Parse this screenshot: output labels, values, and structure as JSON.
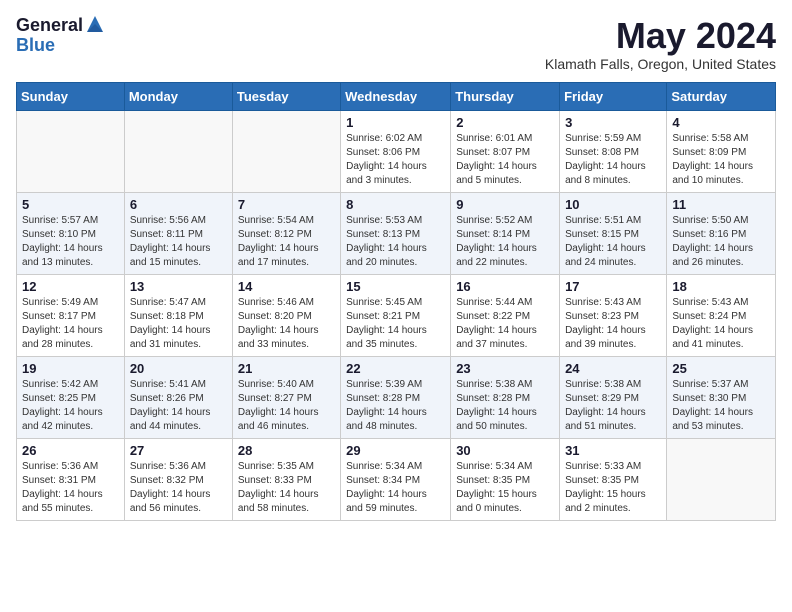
{
  "logo": {
    "general": "General",
    "blue": "Blue"
  },
  "title": "May 2024",
  "location": "Klamath Falls, Oregon, United States",
  "weekdays": [
    "Sunday",
    "Monday",
    "Tuesday",
    "Wednesday",
    "Thursday",
    "Friday",
    "Saturday"
  ],
  "weeks": [
    [
      {
        "day": "",
        "info": ""
      },
      {
        "day": "",
        "info": ""
      },
      {
        "day": "",
        "info": ""
      },
      {
        "day": "1",
        "info": "Sunrise: 6:02 AM\nSunset: 8:06 PM\nDaylight: 14 hours\nand 3 minutes."
      },
      {
        "day": "2",
        "info": "Sunrise: 6:01 AM\nSunset: 8:07 PM\nDaylight: 14 hours\nand 5 minutes."
      },
      {
        "day": "3",
        "info": "Sunrise: 5:59 AM\nSunset: 8:08 PM\nDaylight: 14 hours\nand 8 minutes."
      },
      {
        "day": "4",
        "info": "Sunrise: 5:58 AM\nSunset: 8:09 PM\nDaylight: 14 hours\nand 10 minutes."
      }
    ],
    [
      {
        "day": "5",
        "info": "Sunrise: 5:57 AM\nSunset: 8:10 PM\nDaylight: 14 hours\nand 13 minutes."
      },
      {
        "day": "6",
        "info": "Sunrise: 5:56 AM\nSunset: 8:11 PM\nDaylight: 14 hours\nand 15 minutes."
      },
      {
        "day": "7",
        "info": "Sunrise: 5:54 AM\nSunset: 8:12 PM\nDaylight: 14 hours\nand 17 minutes."
      },
      {
        "day": "8",
        "info": "Sunrise: 5:53 AM\nSunset: 8:13 PM\nDaylight: 14 hours\nand 20 minutes."
      },
      {
        "day": "9",
        "info": "Sunrise: 5:52 AM\nSunset: 8:14 PM\nDaylight: 14 hours\nand 22 minutes."
      },
      {
        "day": "10",
        "info": "Sunrise: 5:51 AM\nSunset: 8:15 PM\nDaylight: 14 hours\nand 24 minutes."
      },
      {
        "day": "11",
        "info": "Sunrise: 5:50 AM\nSunset: 8:16 PM\nDaylight: 14 hours\nand 26 minutes."
      }
    ],
    [
      {
        "day": "12",
        "info": "Sunrise: 5:49 AM\nSunset: 8:17 PM\nDaylight: 14 hours\nand 28 minutes."
      },
      {
        "day": "13",
        "info": "Sunrise: 5:47 AM\nSunset: 8:18 PM\nDaylight: 14 hours\nand 31 minutes."
      },
      {
        "day": "14",
        "info": "Sunrise: 5:46 AM\nSunset: 8:20 PM\nDaylight: 14 hours\nand 33 minutes."
      },
      {
        "day": "15",
        "info": "Sunrise: 5:45 AM\nSunset: 8:21 PM\nDaylight: 14 hours\nand 35 minutes."
      },
      {
        "day": "16",
        "info": "Sunrise: 5:44 AM\nSunset: 8:22 PM\nDaylight: 14 hours\nand 37 minutes."
      },
      {
        "day": "17",
        "info": "Sunrise: 5:43 AM\nSunset: 8:23 PM\nDaylight: 14 hours\nand 39 minutes."
      },
      {
        "day": "18",
        "info": "Sunrise: 5:43 AM\nSunset: 8:24 PM\nDaylight: 14 hours\nand 41 minutes."
      }
    ],
    [
      {
        "day": "19",
        "info": "Sunrise: 5:42 AM\nSunset: 8:25 PM\nDaylight: 14 hours\nand 42 minutes."
      },
      {
        "day": "20",
        "info": "Sunrise: 5:41 AM\nSunset: 8:26 PM\nDaylight: 14 hours\nand 44 minutes."
      },
      {
        "day": "21",
        "info": "Sunrise: 5:40 AM\nSunset: 8:27 PM\nDaylight: 14 hours\nand 46 minutes."
      },
      {
        "day": "22",
        "info": "Sunrise: 5:39 AM\nSunset: 8:28 PM\nDaylight: 14 hours\nand 48 minutes."
      },
      {
        "day": "23",
        "info": "Sunrise: 5:38 AM\nSunset: 8:28 PM\nDaylight: 14 hours\nand 50 minutes."
      },
      {
        "day": "24",
        "info": "Sunrise: 5:38 AM\nSunset: 8:29 PM\nDaylight: 14 hours\nand 51 minutes."
      },
      {
        "day": "25",
        "info": "Sunrise: 5:37 AM\nSunset: 8:30 PM\nDaylight: 14 hours\nand 53 minutes."
      }
    ],
    [
      {
        "day": "26",
        "info": "Sunrise: 5:36 AM\nSunset: 8:31 PM\nDaylight: 14 hours\nand 55 minutes."
      },
      {
        "day": "27",
        "info": "Sunrise: 5:36 AM\nSunset: 8:32 PM\nDaylight: 14 hours\nand 56 minutes."
      },
      {
        "day": "28",
        "info": "Sunrise: 5:35 AM\nSunset: 8:33 PM\nDaylight: 14 hours\nand 58 minutes."
      },
      {
        "day": "29",
        "info": "Sunrise: 5:34 AM\nSunset: 8:34 PM\nDaylight: 14 hours\nand 59 minutes."
      },
      {
        "day": "30",
        "info": "Sunrise: 5:34 AM\nSunset: 8:35 PM\nDaylight: 15 hours\nand 0 minutes."
      },
      {
        "day": "31",
        "info": "Sunrise: 5:33 AM\nSunset: 8:35 PM\nDaylight: 15 hours\nand 2 minutes."
      },
      {
        "day": "",
        "info": ""
      }
    ]
  ]
}
